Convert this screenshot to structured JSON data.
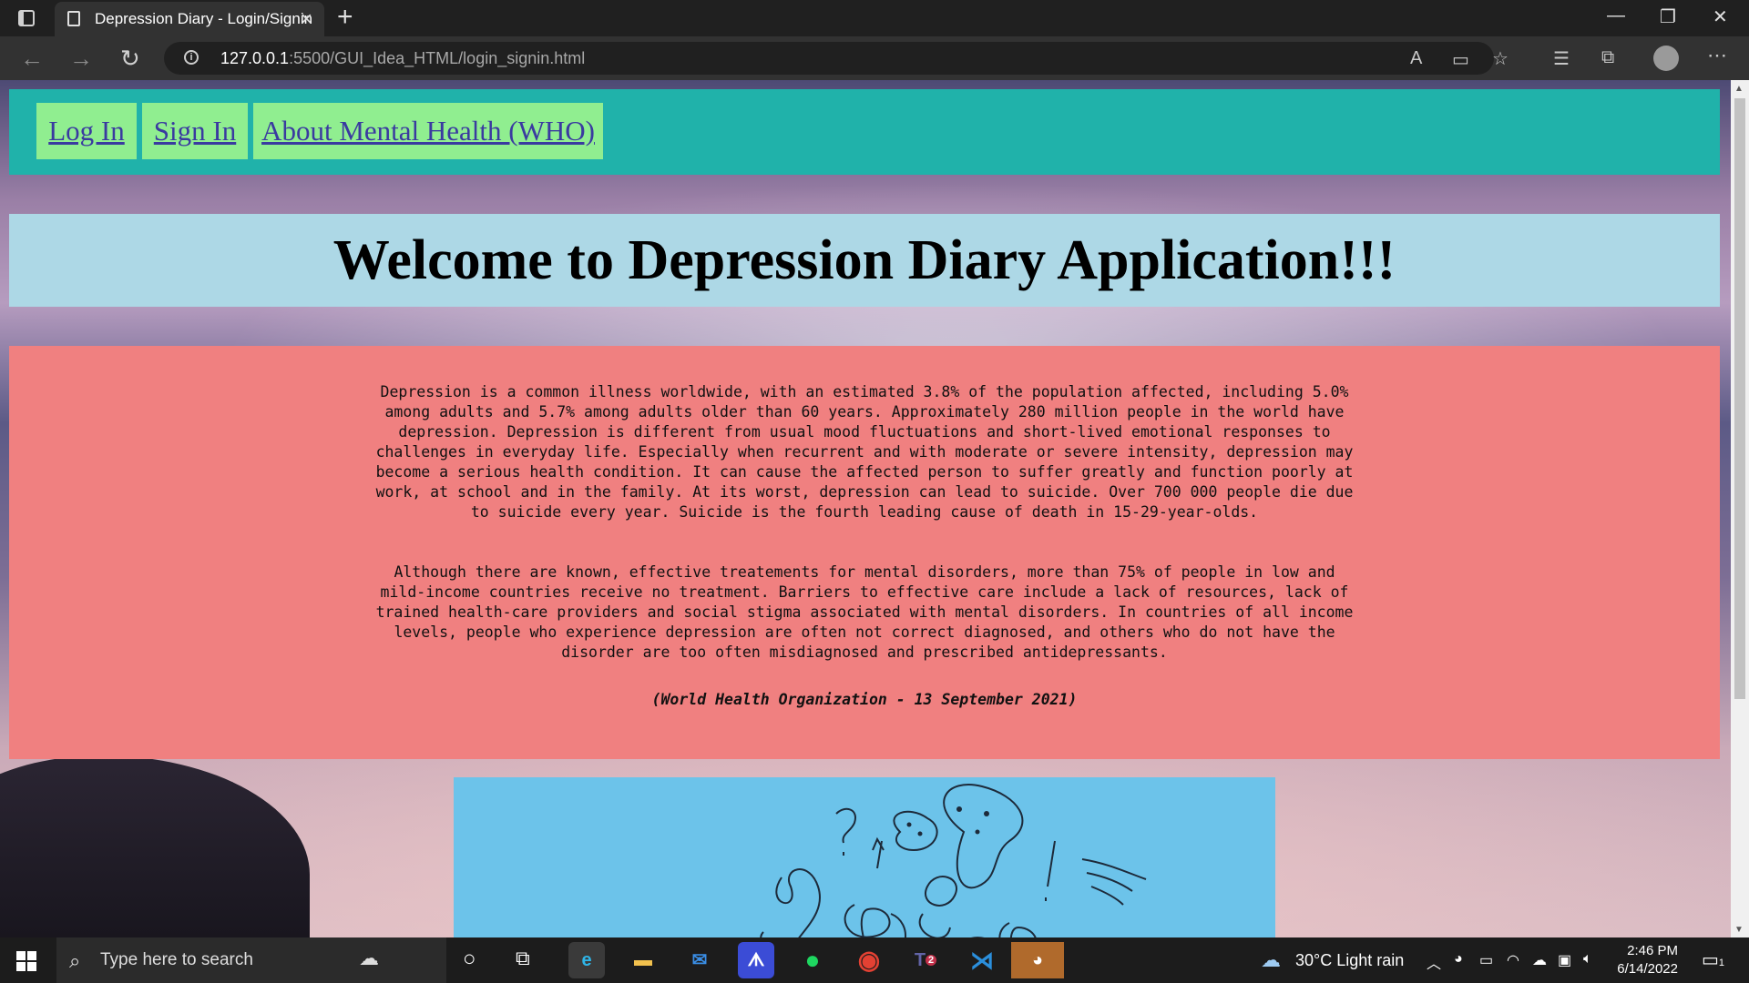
{
  "browser": {
    "tab_title": "Depression Diary - Login/Signin",
    "tab_close": "×",
    "new_tab": "+",
    "url_host": "127.0.0.1",
    "url_path": ":5500/GUI_Idea_HTML/login_signin.html",
    "window_controls": [
      "—",
      "❐",
      "✕"
    ]
  },
  "nav": {
    "login_label": "Log In",
    "signin_label": "Sign In",
    "about_label": "About Mental Health (WHO)"
  },
  "welcome": "Welcome to Depression Diary Application!!!",
  "info": {
    "paragraph1": "Depression is a common illness worldwide, with an estimated 3.8% of the population affected, including 5.0% among adults and 5.7% among adults older than 60 years. Approximately 280 million people in the world have depression. Depression is different from usual mood fluctuations and short-lived emotional responses to challenges in everyday life. Especially when recurrent and with moderate or severe intensity, depression may become a serious health condition. It can cause the affected person to suffer greatly and function poorly at work, at school and in the family. At its worst, depression can lead to suicide. Over 700 000 people die due to suicide every year. Suicide is the fourth leading cause of death in 15-29-year-olds.",
    "paragraph2": "Although there are known, effective treatements for mental disorders, more than 75% of people in low and mild-income countries receive no treatment. Barriers to effective care include a lack of resources, lack of trained health-care providers and social stigma associated with mental disorders. In countries of all income levels, people who experience depression are often not correct diagnosed, and others who do not have the disorder are too often misdiagnosed and prescribed antidepressants.",
    "citation": "(World Health Organization - 13 September 2021)"
  },
  "taskbar": {
    "search_placeholder": "Type here to search",
    "weather": "30°C  Light rain",
    "time": "2:46 PM",
    "date": "6/14/2022",
    "notification_count": "1",
    "teams_badge": "2"
  },
  "colors": {
    "navbar": "#20b2aa",
    "nav_button": "#90ee90",
    "welcome_bg": "#add8e6",
    "info_bg": "#f08080",
    "illustration_bg": "#6cc3ea"
  }
}
